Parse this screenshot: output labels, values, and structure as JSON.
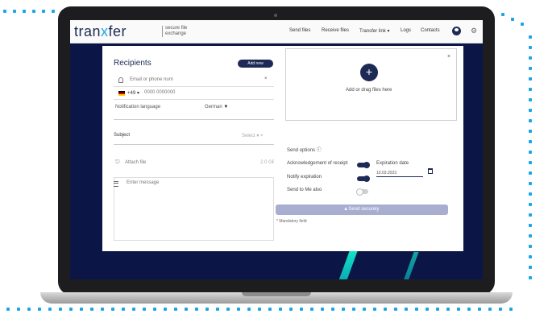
{
  "brand": {
    "name_pre": "tran",
    "name_x": "x",
    "name_post": "fer",
    "tagline_1": "secure file",
    "tagline_2": "exchange"
  },
  "nav": {
    "send_files": "Send files",
    "receive_files": "Receive files",
    "transfer_link": "Transfer link",
    "logs": "Logs",
    "contacts": "Contacts"
  },
  "recipients": {
    "title": "Recipients",
    "add_new_label": "Add new",
    "email_placeholder": "Email or phone num",
    "phone_prefix": "+49",
    "phone_placeholder": "0000 0000000",
    "language_label": "Notification language",
    "language_value": "German"
  },
  "subject": {
    "label": "Subject",
    "select_label": "Select"
  },
  "attach": {
    "label": "Attach file",
    "limit": "2.0 GB"
  },
  "message": {
    "placeholder": "Enter message"
  },
  "upload": {
    "label": "Add or drag files here"
  },
  "options": {
    "title": "Send options",
    "ack_label": "Acknowledgement of receipt",
    "ack_on": true,
    "notify_label": "Notify expiration",
    "notify_on": true,
    "sendme_label": "Send to Me also",
    "sendme_on": false,
    "expiration_label": "Expiration date",
    "expiration_value": "10.03.2023"
  },
  "send_button": "Send securely",
  "required_note": "Mandatory field",
  "colors": {
    "brand": "#1c2a55",
    "accent": "#1aa6e6",
    "button_disabled": "#a7aed0"
  }
}
